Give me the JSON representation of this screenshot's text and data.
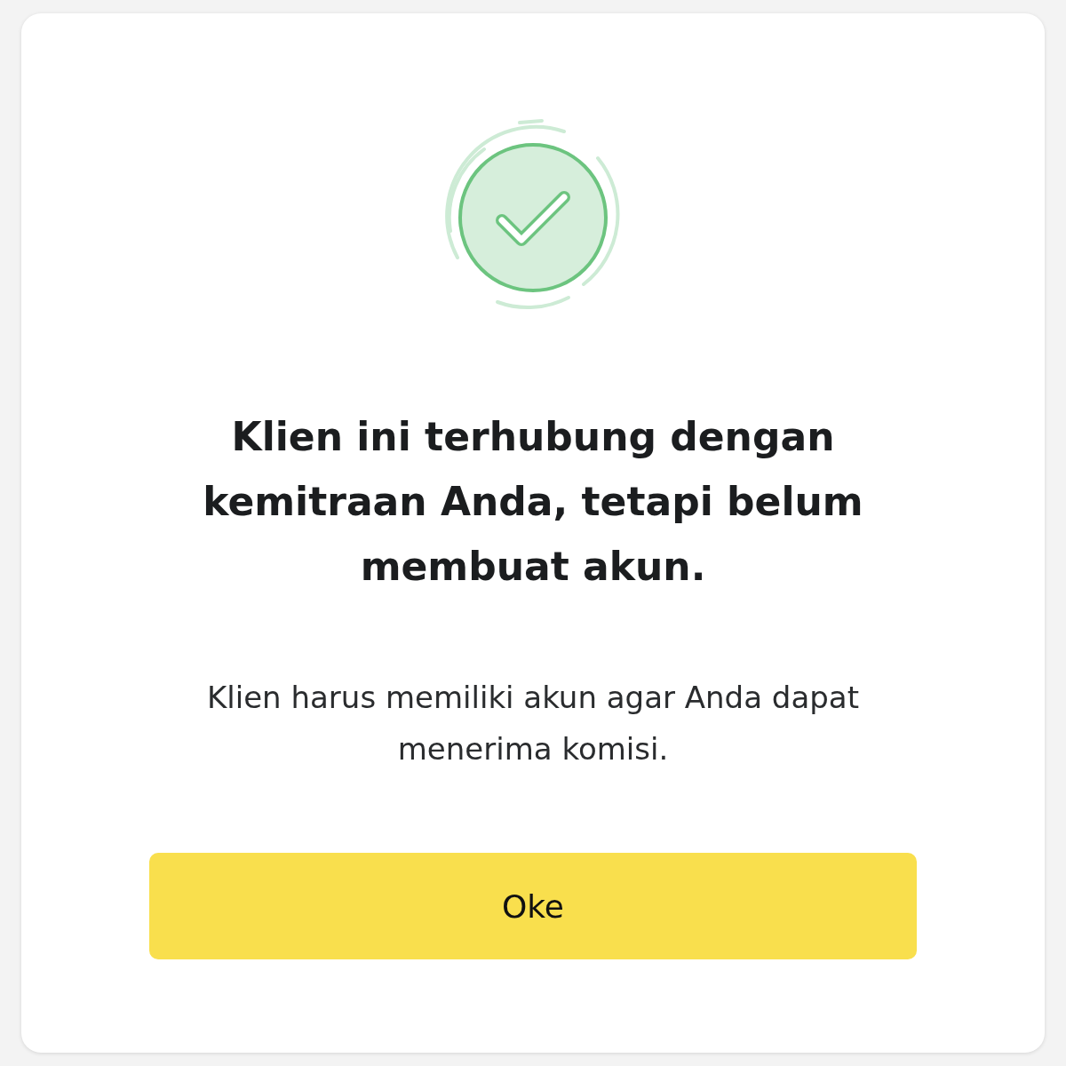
{
  "dialog": {
    "title": "Klien ini terhubung dengan kemitraan Anda, tetapi belum membuat akun.",
    "message": "Klien harus memiliki akun agar Anda dapat menerima komisi.",
    "button": "Oke"
  }
}
